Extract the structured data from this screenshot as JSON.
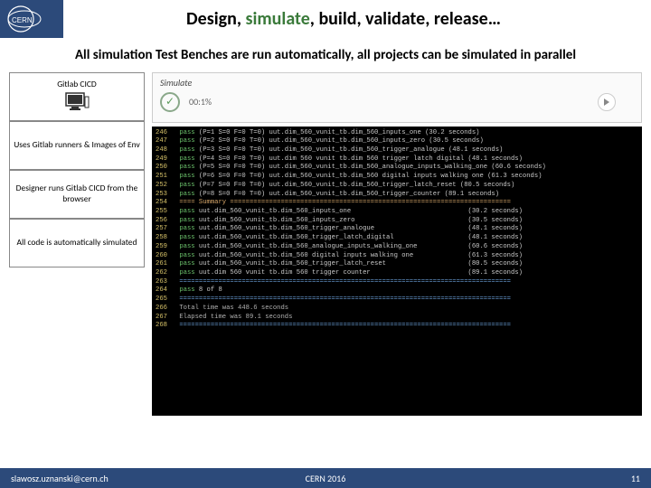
{
  "header": {
    "title_pre": "Design, ",
    "title_sim": "simulate",
    "title_post": ", build, validate, release…"
  },
  "subhead": "All simulation Test Benches are run automatically, all projects can be simulated in parallel",
  "sidebar": {
    "box1": "Gitlab CICD",
    "box2": "Uses Gitlab runners & Images of Env",
    "box3": "Designer runs Gitlab CICD from the browser",
    "box4": "All code is automatically simulated"
  },
  "simpanel": {
    "title": "Simulate",
    "percent": "00:1%"
  },
  "terminal": {
    "lines": [
      {
        "n": "246",
        "s": "pass",
        "t": "(P=1 S=0 F=0 T=0) uut.dim_560_vunit_tb.dim_560_inputs_one (30.2 seconds)"
      },
      {
        "n": "247",
        "s": "pass",
        "t": "(P=2 S=0 F=0 T=0) uut.dim_560_vunit_tb.dim_560_inputs_zero (30.5 seconds)"
      },
      {
        "n": "248",
        "s": "pass",
        "t": "(P=3 S=0 F=0 T=0) uut.dim_560_vunit_tb.dim_560_trigger_analogue (48.1 seconds)"
      },
      {
        "n": "249",
        "s": "pass",
        "t": "(P=4 S=0 F=0 T=0) uut.dim 560 vunit tb.dim 560 trigger latch digital (48.1 seconds)"
      },
      {
        "n": "250",
        "s": "pass",
        "t": "(P=5 S=0 F=0 T=0) uut.dim_560_vunit_tb.dim_560_analogue_inputs_walking_one (60.6 seconds)"
      },
      {
        "n": "251",
        "s": "pass",
        "t": "(P=6 S=0 F=0 T=0) uut.dim_560_vunit_tb.dim_560 digital inputs walking one (61.3 seconds)"
      },
      {
        "n": "252",
        "s": "pass",
        "t": "(P=7 S=0 F=0 T=0) uut.dim_560_vunit_tb.dim_560_trigger_latch_reset (80.5 seconds)"
      },
      {
        "n": "253",
        "s": "pass",
        "t": "(P=8 S=0 F=0 T=0) uut.dim_560_vunit_tb.dim_560_trigger_counter (89.1 seconds)"
      },
      {
        "n": "254",
        "s": "sum",
        "t": "==== Summary ========================================================================"
      },
      {
        "n": "255",
        "s": "pass",
        "t": "uut.dim_560_vunit_tb.dim_560_inputs_one                              (30.2 seconds)"
      },
      {
        "n": "256",
        "s": "pass",
        "t": "uut.dim_560_vunit_tb.dim_560_inputs_zero                             (30.5 seconds)"
      },
      {
        "n": "257",
        "s": "pass",
        "t": "uut.dim_560_vunit_tb.dim_560_trigger_analogue                        (48.1 seconds)"
      },
      {
        "n": "258",
        "s": "pass",
        "t": "uut.dim_560_vunit_tb.dim_560_trigger_latch_digital                   (48.1 seconds)"
      },
      {
        "n": "259",
        "s": "pass",
        "t": "uut.dim_560_vunit_tb.dim_560_analogue_inputs_walking_one             (60.6 seconds)"
      },
      {
        "n": "260",
        "s": "pass",
        "t": "uut.dim_560_vunit_tb.dim_560 digital inputs walking one              (61.3 seconds)"
      },
      {
        "n": "261",
        "s": "pass",
        "t": "uut.dim_560_vunit_tb.dim_560_trigger_latch_reset                     (80.5 seconds)"
      },
      {
        "n": "262",
        "s": "pass",
        "t": "uut.dim 560 vunit tb.dim 560 trigger counter                         (89.1 seconds)"
      },
      {
        "n": "263",
        "s": "dash",
        "t": "====================================================================================="
      },
      {
        "n": "264",
        "s": "pass",
        "t": "8 of 8"
      },
      {
        "n": "265",
        "s": "dash",
        "t": "====================================================================================="
      },
      {
        "n": "266",
        "s": "time",
        "t": "Total time was 448.6 seconds"
      },
      {
        "n": "267",
        "s": "time",
        "t": "Elapsed time was 89.1 seconds"
      },
      {
        "n": "268",
        "s": "dash",
        "t": "====================================================================================="
      }
    ]
  },
  "footer": {
    "email": "slawosz.uznanski@cern.ch",
    "conf": "CERN 2016",
    "page": "11"
  }
}
